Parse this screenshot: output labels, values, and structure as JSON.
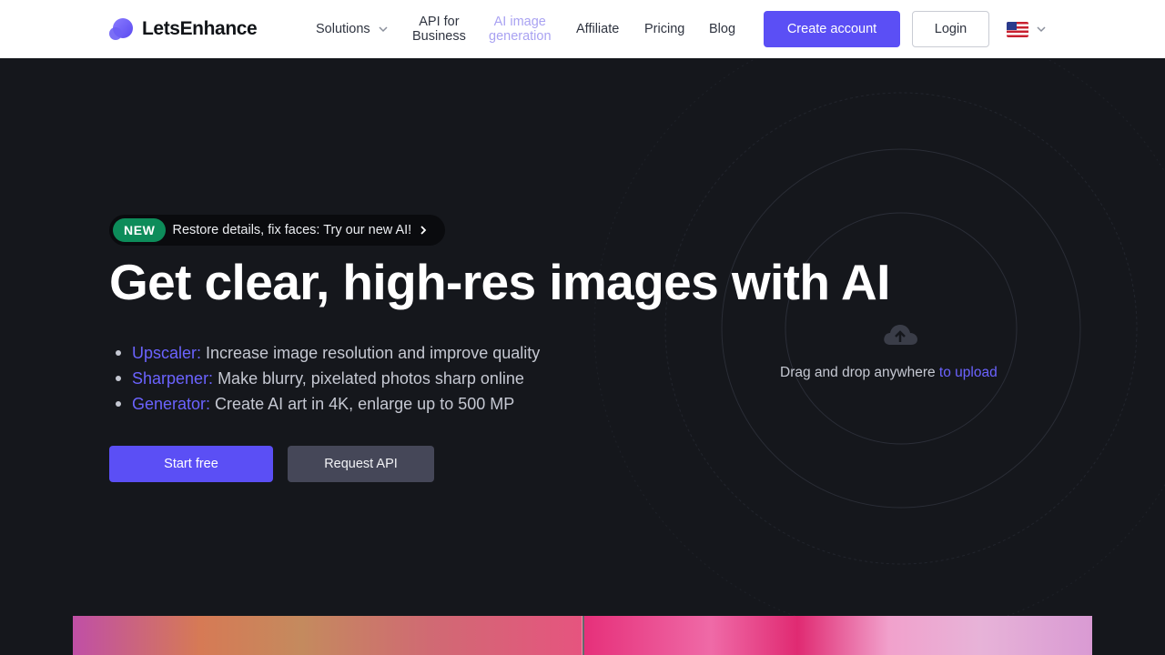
{
  "header": {
    "brand": "LetsEnhance",
    "nav": {
      "solutions": "Solutions",
      "api_line1": "API for",
      "api_line2": "Business",
      "ai_line1": "AI image",
      "ai_line2": "generation",
      "affiliate": "Affiliate",
      "pricing": "Pricing",
      "blog": "Blog"
    },
    "create_account": "Create account",
    "login": "Login",
    "language_flag": "us-flag-icon"
  },
  "hero": {
    "badge_label": "NEW",
    "badge_text": "Restore details, fix faces: Try our new AI!",
    "title": "Get clear, high-res images with AI",
    "features": [
      {
        "key": "Upscaler:",
        "text": " Increase image resolution and improve quality"
      },
      {
        "key": "Sharpener:",
        "text": " Make blurry, pixelated photos sharp online"
      },
      {
        "key": "Generator:",
        "text": " Create AI art in 4K, enlarge up to 500 MP"
      }
    ],
    "start_free": "Start free",
    "request_api": "Request API"
  },
  "upload": {
    "text": "Drag and drop anywhere ",
    "link": "to upload"
  },
  "colors": {
    "accent": "#5b4ff5",
    "link": "#6b63ff",
    "badge_green": "#0d8c5a",
    "background": "#15171c"
  }
}
